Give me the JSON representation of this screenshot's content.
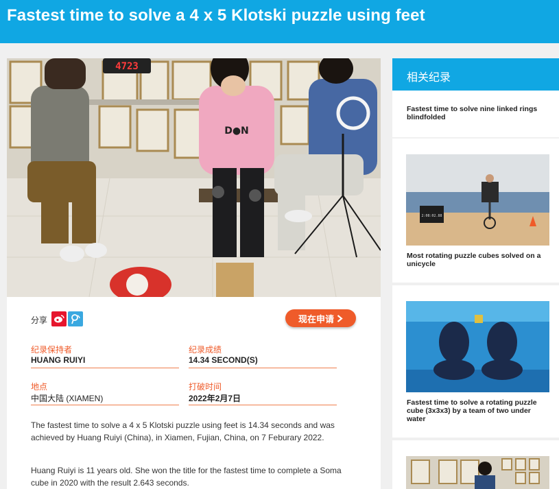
{
  "header": {
    "title": "Fastest time to solve a 4 x 5 Klotski puzzle using feet"
  },
  "hero": {
    "timer_display": "4723"
  },
  "share": {
    "label": "分享"
  },
  "apply": {
    "label": "现在申请"
  },
  "record": {
    "holder_label": "纪录保持者",
    "holder_value": "HUANG RUIYI",
    "result_label": "纪录成绩",
    "result_value": "14.34 SECOND(S)",
    "location_label": "地点",
    "location_value": "中国大陆 (XIAMEN)",
    "date_label": "打破时间",
    "date_value": "2022年2月7日"
  },
  "description": {
    "para1": "The fastest time to solve a 4 x 5 Klotski puzzle using feet is 14.34 seconds and was achieved by Huang Ruiyi (China), in Xiamen, Fujian, China, on 7 Feburary 2022.",
    "para2": "Huang Ruiyi is 11 years old. She won the title for the fastest time to complete a Soma cube in 2020 with the result 2.643 seconds."
  },
  "sidebar": {
    "title": "相关纪录",
    "items": [
      {
        "title": "Fastest time to solve nine linked rings blindfolded"
      },
      {
        "title": "Most rotating puzzle cubes solved on a unicycle",
        "timer_display": "2:08:02.88"
      },
      {
        "title": "Fastest time to solve a rotating puzzle cube (3x3x3) by a team of two under water"
      },
      {
        "title": ""
      }
    ]
  },
  "colors": {
    "brand_blue": "#10a7e3",
    "accent_orange": "#ef5b2a"
  }
}
